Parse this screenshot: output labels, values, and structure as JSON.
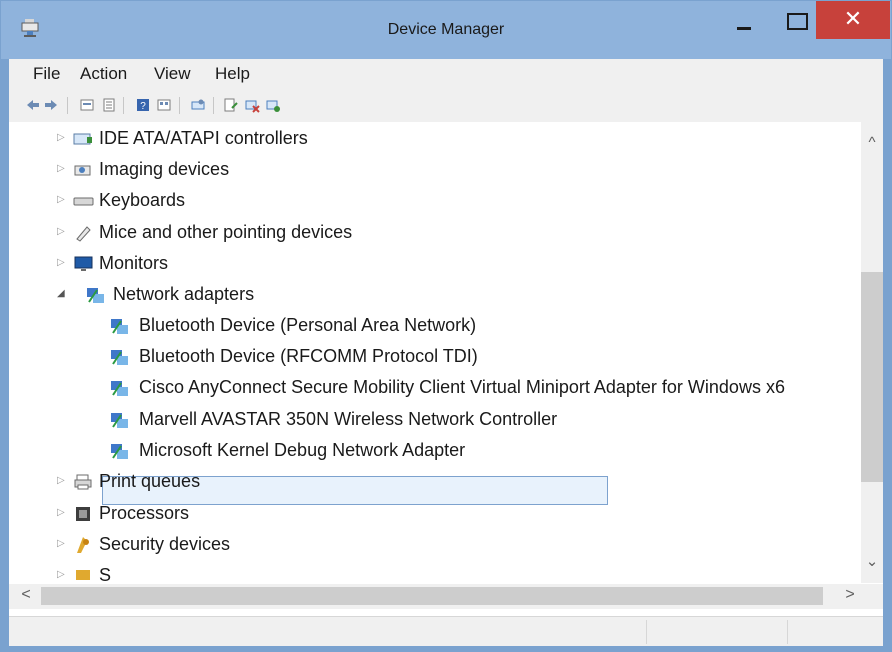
{
  "window": {
    "title": "Device Manager",
    "close_glyph": "✕"
  },
  "menu": {
    "items": [
      {
        "label": "File"
      },
      {
        "label": "Action"
      },
      {
        "label": "View"
      },
      {
        "label": "Help"
      }
    ]
  },
  "toolbar": {
    "icons": [
      "back-icon",
      "forward-icon",
      "properties-icon",
      "properties-sheet-icon",
      "help-icon",
      "view-icon",
      "scan-icon",
      "update-driver-icon",
      "disable-device-icon",
      "uninstall-device-icon"
    ]
  },
  "tree": {
    "rows": [
      {
        "label": "IDE ATA/ATAPI controllers",
        "level": 0,
        "state": "collapsed"
      },
      {
        "label": "Imaging devices",
        "level": 0,
        "state": "collapsed"
      },
      {
        "label": "Keyboards",
        "level": 0,
        "state": "collapsed"
      },
      {
        "label": "Mice and other pointing devices",
        "level": 0,
        "state": "collapsed"
      },
      {
        "label": "Monitors",
        "level": 0,
        "state": "collapsed"
      },
      {
        "label": "Network adapters",
        "level": 0,
        "state": "expanded"
      },
      {
        "label": "Bluetooth Device (Personal Area Network)",
        "level": 1
      },
      {
        "label": "Bluetooth Device (RFCOMM Protocol TDI)",
        "level": 1
      },
      {
        "label": "Cisco AnyConnect Secure Mobility Client Virtual Miniport Adapter for Windows x6",
        "level": 1
      },
      {
        "label": "Marvell AVASTAR 350N Wireless Network Controller",
        "level": 1,
        "selected": true
      },
      {
        "label": "Microsoft Kernel Debug Network Adapter",
        "level": 1
      },
      {
        "label": "Print queues",
        "level": 0,
        "state": "collapsed"
      },
      {
        "label": "Processors",
        "level": 0,
        "state": "collapsed"
      },
      {
        "label": "Security devices",
        "level": 0,
        "state": "collapsed"
      },
      {
        "label": "S",
        "level": 0,
        "state": "collapsed"
      }
    ]
  },
  "scroll": {
    "up": "^",
    "down": "⌄",
    "left": "<",
    "right": ">"
  },
  "colors": {
    "title_bar": "#8fb3dc",
    "close_button": "#c7413b",
    "selection_border": "#7da2ce",
    "selection_fill": "#e8f2fc"
  }
}
